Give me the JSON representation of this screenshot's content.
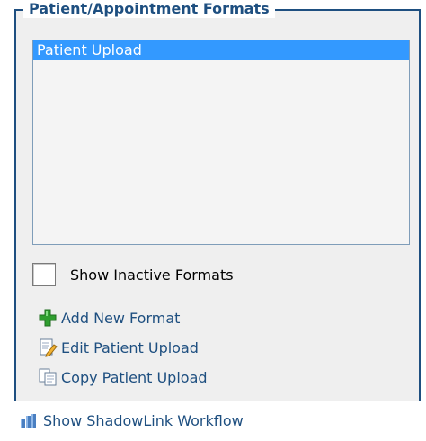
{
  "panel": {
    "title": "Patient/Appointment Formats",
    "list_items": [
      {
        "label": "Patient Upload",
        "selected": true
      }
    ],
    "show_inactive": {
      "label": "Show Inactive Formats",
      "checked": false
    },
    "actions": {
      "add_label": "Add New Format",
      "edit_label": "Edit Patient Upload",
      "copy_label": "Copy Patient Upload"
    }
  },
  "footer": {
    "workflow_label": "Show ShadowLink Workflow"
  },
  "icons": {
    "add": "plus-icon",
    "edit": "edit-document-icon",
    "copy": "copy-document-icon",
    "workflow": "workflow-icon"
  },
  "colors": {
    "accent": "#1e4f80",
    "selection": "#3399ff"
  }
}
